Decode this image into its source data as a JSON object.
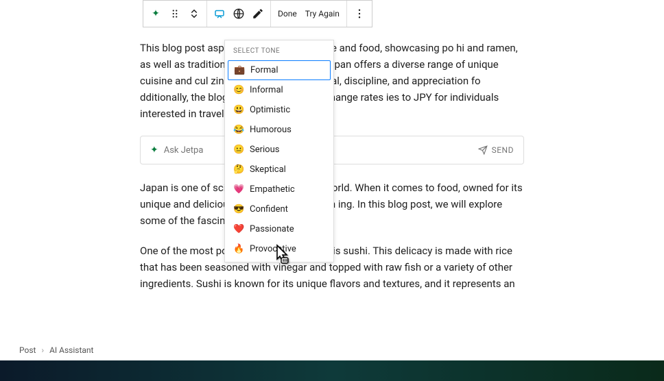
{
  "toolbar": {
    "done_label": "Done",
    "try_again_label": "Try Again"
  },
  "dropdown": {
    "header": "SELECT TONE",
    "items": [
      {
        "emoji": "💼",
        "label": "Formal"
      },
      {
        "emoji": "😊",
        "label": "Informal"
      },
      {
        "emoji": "😃",
        "label": "Optimistic"
      },
      {
        "emoji": "😂",
        "label": "Humorous"
      },
      {
        "emoji": "😐",
        "label": "Serious"
      },
      {
        "emoji": "🤔",
        "label": "Skeptical"
      },
      {
        "emoji": "💗",
        "label": "Empathetic"
      },
      {
        "emoji": "😎",
        "label": "Confident"
      },
      {
        "emoji": "❤️",
        "label": "Passionate"
      },
      {
        "emoji": "🔥",
        "label": "Provocative"
      }
    ]
  },
  "ask_bar": {
    "placeholder_prefix": "Ask Jetpa",
    "send_label": "SEND"
  },
  "paragraphs": {
    "p1": "This blog post aspects of Japanese culture and food, showcasing po hi and ramen, as well as traditional tea ceremonies an Japan offers a diverse range of unique cuisine and cul zing the importance of ritual, discipline, and appreciation fo dditionally, the blog provides currency exchange rates ies to JPY for individuals interested in traveling to Jap",
    "p2": "Japan is one of scinating cultures in the world. When it comes to food, owned for its unique and delicious dishes that are both h ing. In this blog post, we will explore some of the fascinati culture and food.",
    "p3": "One of the most popular Japanese dishes is sushi. This delicacy is made with rice that has been seasoned with vinegar and topped with raw fish or a variety of other ingredients. Sushi is known for its unique flavors and textures, and it represents an"
  },
  "breadcrumb": {
    "root": "Post",
    "current": "AI Assistant"
  }
}
